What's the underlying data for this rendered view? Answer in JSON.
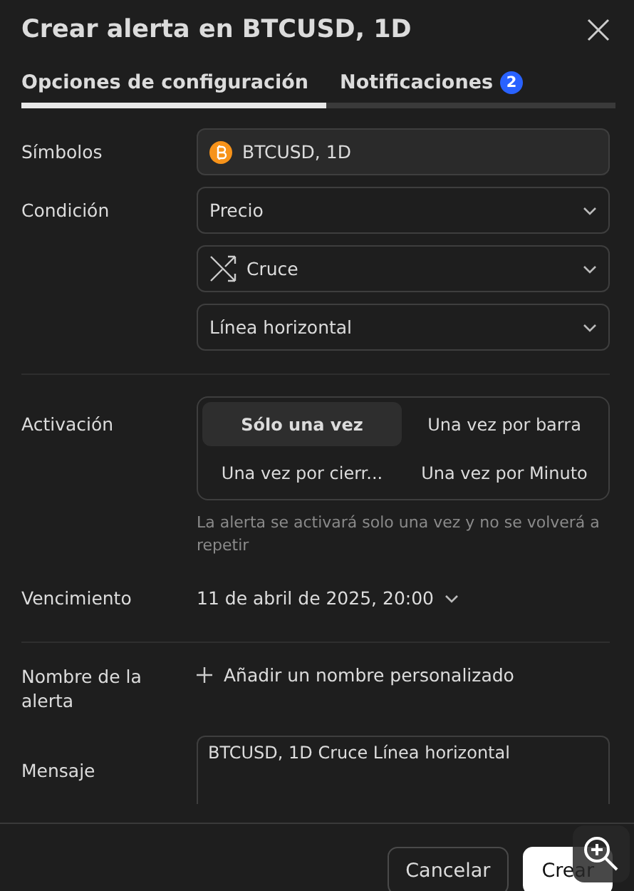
{
  "dialog": {
    "title": "Crear alerta en BTCUSD, 1D"
  },
  "tabs": [
    {
      "label": "Opciones de configuración",
      "selected": true
    },
    {
      "label": "Notificaciones",
      "badge": "2",
      "selected": false
    }
  ],
  "symbols": {
    "label": "Símbolos",
    "value": "BTCUSD, 1D"
  },
  "condition": {
    "label": "Condición",
    "selects": [
      {
        "kind": "plain",
        "value": "Precio"
      },
      {
        "kind": "crossing",
        "value": "Cruce"
      },
      {
        "kind": "plain",
        "value": "Línea horizontal"
      }
    ]
  },
  "activation": {
    "label": "Activación",
    "options": [
      {
        "label": "Sólo una vez",
        "selected": true
      },
      {
        "label": "Una vez por barra",
        "selected": false
      },
      {
        "label": "Una vez por cierr...",
        "selected": false
      },
      {
        "label": "Una vez por Minuto",
        "selected": false
      }
    ],
    "hint": "La alerta se activará solo una vez y no se volverá a repetir"
  },
  "expiration": {
    "label": "Vencimiento",
    "value": "11 de abril de 2025, 20:00"
  },
  "alert_name": {
    "label": "Nombre de la alerta",
    "action": "Añadir un nombre personalizado"
  },
  "message": {
    "label": "Mensaje",
    "value": "BTCUSD, 1D Cruce Línea horizontal"
  },
  "buttons": [
    {
      "label": "Cancelar",
      "kind": "secondary"
    },
    {
      "label": "Crear",
      "kind": "primary"
    }
  ]
}
